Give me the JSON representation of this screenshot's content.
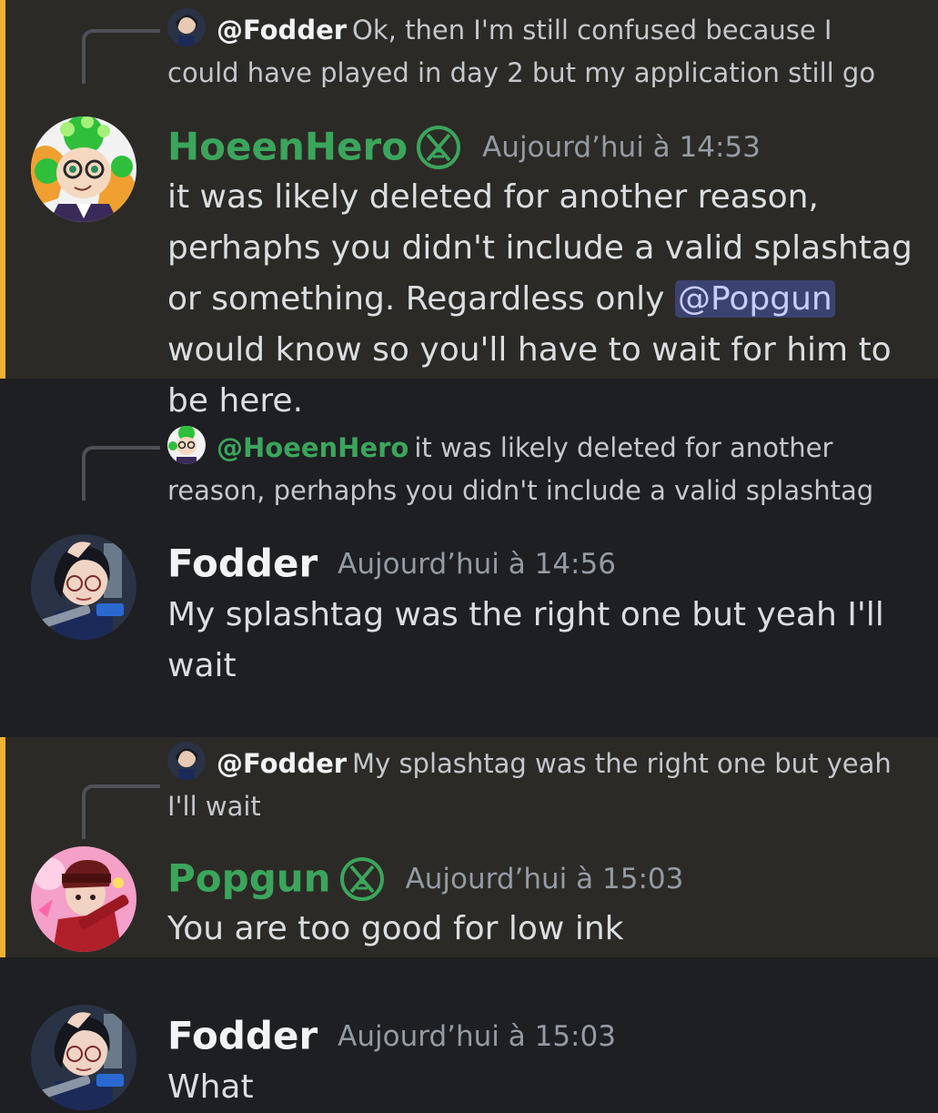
{
  "messages": [
    {
      "reply_name": "@Fodder",
      "reply_text": "Ok, then I'm still confused because I could have played in day 2 but my application still go",
      "author": "HoeenHero",
      "badge_icon": "moderator-badge-icon",
      "timestamp": "Aujourd’hui à 14:53",
      "content_before": "it was likely deleted for another reason, perhaphs you didn't include a valid splashtag or something. Regardless only ",
      "mention": "@Popgun",
      "content_after": " would know so you'll have to wait for him to be here."
    },
    {
      "reply_name": "@HoeenHero",
      "reply_text": "it was likely deleted for another reason, perhaphs you didn't include a valid splashtag",
      "author": "Fodder",
      "timestamp": "Aujourd’hui à 14:56",
      "content": "My splashtag was the right one but yeah I'll wait"
    },
    {
      "reply_name": "@Fodder",
      "reply_text": "My splashtag was the right one but yeah I'll wait",
      "author": "Popgun",
      "badge_icon": "moderator-badge-icon",
      "timestamp": "Aujourd’hui à 15:03",
      "content": "You are too good for low ink"
    },
    {
      "author": "Fodder",
      "timestamp": "Aujourd’hui à 15:03",
      "content": "What"
    }
  ],
  "colors": {
    "background": "#1e1f22",
    "mention_highlight_bg": "#2c2a26",
    "mention_bar": "#f0b232",
    "role_green": "#3ba55c",
    "mention_pill_bg": "#3c4270",
    "timestamp": "#949ba4"
  }
}
